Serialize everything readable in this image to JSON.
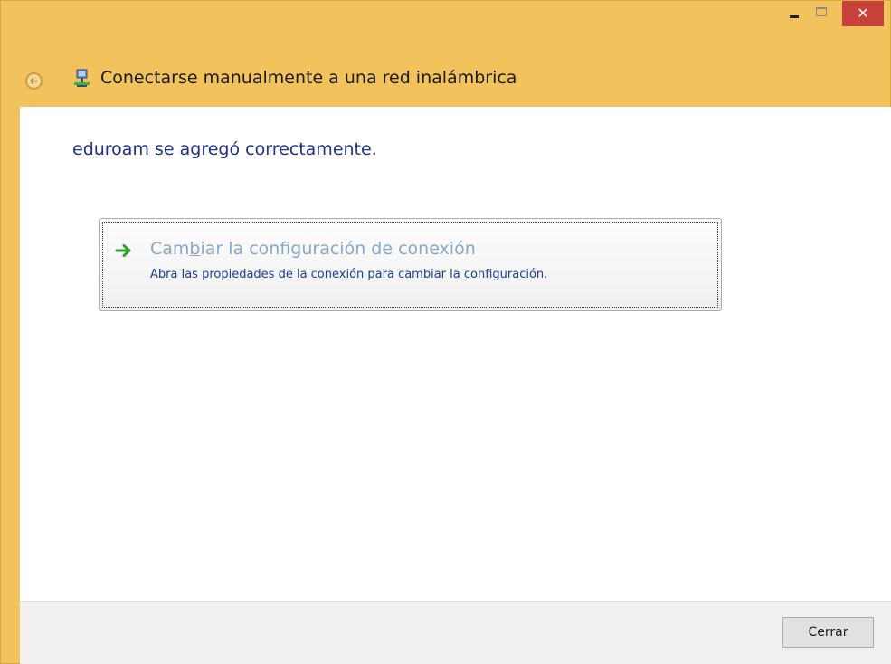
{
  "window": {
    "title": "Conectarse manualmente a una red inalámbrica",
    "caption": {
      "minimize_icon": "minimize-icon",
      "maximize_icon": "maximize-icon",
      "close_glyph": "✕"
    },
    "accent_color": "#f2c35d",
    "close_color": "#c7403a"
  },
  "nav": {
    "back_icon": "back-arrow-icon",
    "app_icon": "network-icon"
  },
  "content": {
    "success_message": "eduroam se agregó correctamente.",
    "command_link": {
      "icon": "green-arrow-icon",
      "title_before": "Cam",
      "title_access_key": "b",
      "title_after": "iar la configuración de conexión",
      "description": "Abra las propiedades de la conexión para cambiar la configuración."
    }
  },
  "footer": {
    "close_label": "Cerrar"
  }
}
